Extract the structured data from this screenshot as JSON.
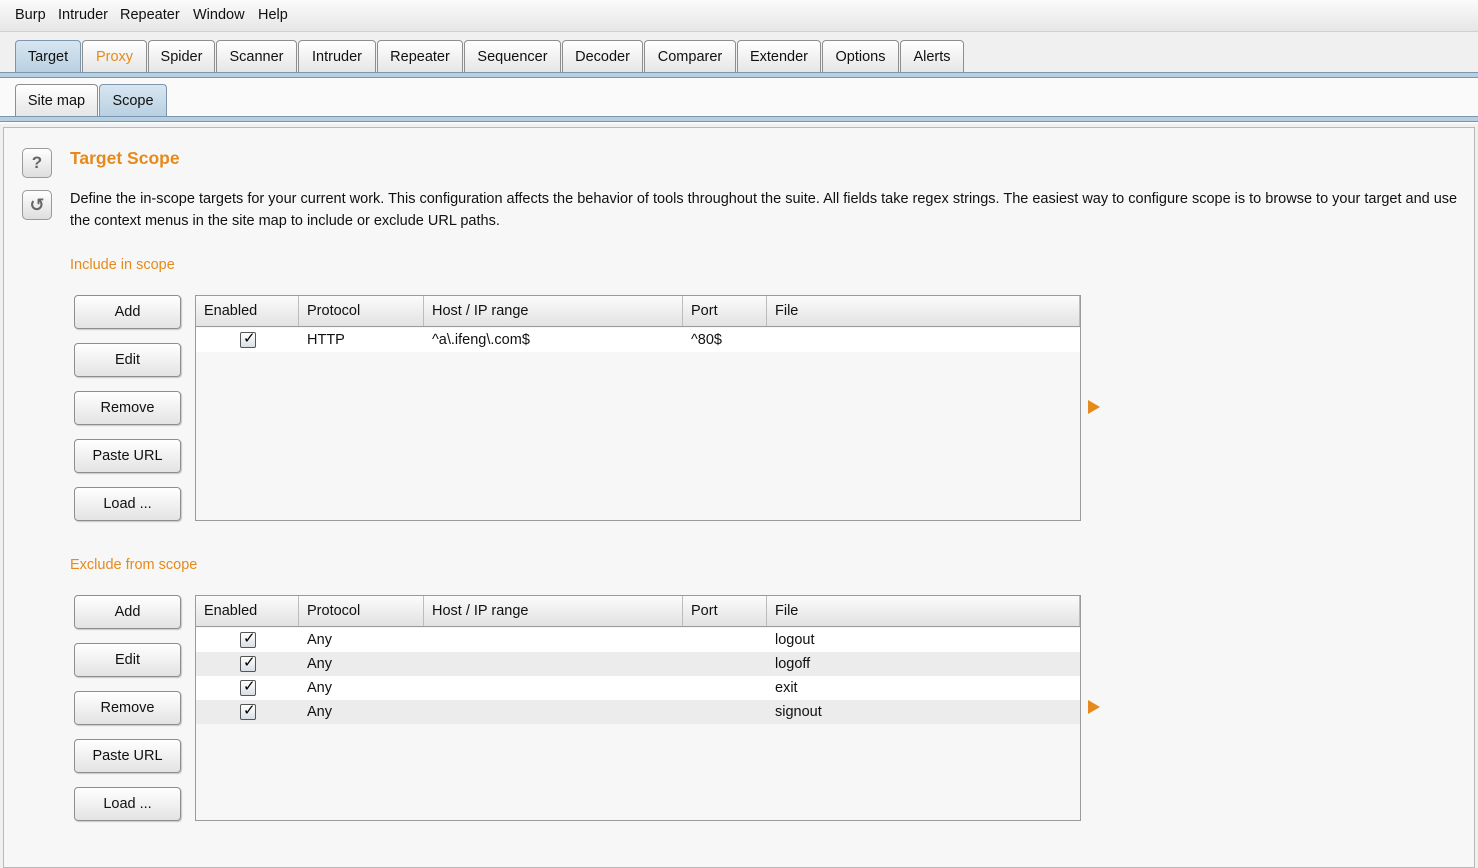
{
  "menu": [
    "Burp",
    "Intruder",
    "Repeater",
    "Window",
    "Help"
  ],
  "main_tabs": [
    "Target",
    "Proxy",
    "Spider",
    "Scanner",
    "Intruder",
    "Repeater",
    "Sequencer",
    "Decoder",
    "Comparer",
    "Extender",
    "Options",
    "Alerts"
  ],
  "active_main_tab": "Target",
  "sub_tabs": [
    "Site map",
    "Scope"
  ],
  "active_sub_tab": "Scope",
  "icons": {
    "help": "?",
    "refresh": "↺"
  },
  "scope": {
    "title": "Target Scope",
    "description": "Define the in-scope targets for your current work. This configuration affects the behavior of tools throughout the suite. All fields take regex strings. The easiest way to configure scope is to browse to your target and use the context menus in the site map to include or exclude URL paths."
  },
  "include": {
    "label": "Include in scope",
    "buttons": [
      "Add",
      "Edit",
      "Remove",
      "Paste URL",
      "Load ..."
    ],
    "columns": [
      "Enabled",
      "Protocol",
      "Host / IP range",
      "Port",
      "File"
    ],
    "rows": [
      {
        "enabled": true,
        "protocol": "HTTP",
        "host": "^a\\.ifeng\\.com$",
        "port": "^80$",
        "file": ""
      }
    ]
  },
  "exclude": {
    "label": "Exclude from scope",
    "buttons": [
      "Add",
      "Edit",
      "Remove",
      "Paste URL",
      "Load ..."
    ],
    "columns": [
      "Enabled",
      "Protocol",
      "Host / IP range",
      "Port",
      "File"
    ],
    "rows": [
      {
        "enabled": true,
        "protocol": "Any",
        "host": "",
        "port": "",
        "file": "logout"
      },
      {
        "enabled": true,
        "protocol": "Any",
        "host": "",
        "port": "",
        "file": "logoff"
      },
      {
        "enabled": true,
        "protocol": "Any",
        "host": "",
        "port": "",
        "file": "exit"
      },
      {
        "enabled": true,
        "protocol": "Any",
        "host": "",
        "port": "",
        "file": "signout"
      }
    ]
  },
  "colors": {
    "accent": "#e58a1b",
    "tab_active": "#b6cfe1"
  }
}
